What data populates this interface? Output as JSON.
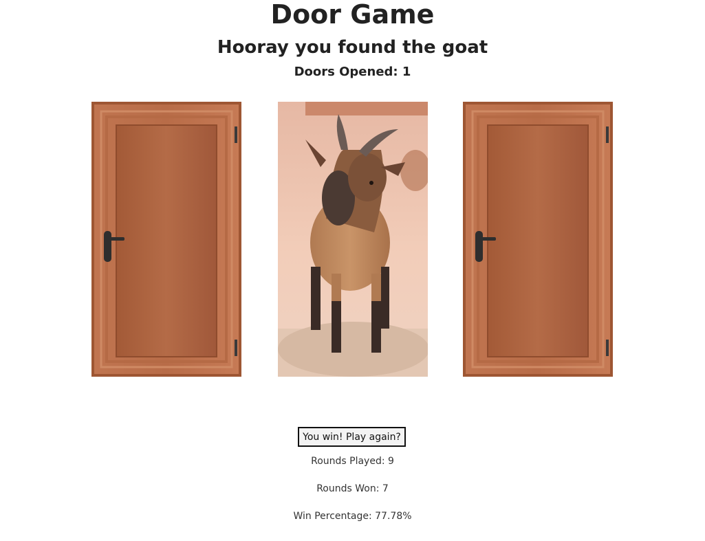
{
  "header": {
    "title": "Door Game",
    "message": "Hooray you found the goat",
    "doors_opened_label": "Doors Opened: 1"
  },
  "doors": [
    {
      "id": "door-1",
      "state": "closed",
      "icon": "wooden-door-icon"
    },
    {
      "id": "door-2",
      "state": "open",
      "content": "goat",
      "icon": "goat-image"
    },
    {
      "id": "door-3",
      "state": "closed",
      "icon": "wooden-door-icon"
    }
  ],
  "controls": {
    "play_again_label": "You win! Play again?"
  },
  "stats": {
    "rounds_played": "Rounds Played: 9",
    "rounds_won": "Rounds Won: 7",
    "win_percentage": "Win Percentage: 77.78%"
  },
  "colors": {
    "door_wood": "#b46a45",
    "door_frame": "#a65a36",
    "door_panel": "#9c5634",
    "handle": "#2e2e2e"
  }
}
